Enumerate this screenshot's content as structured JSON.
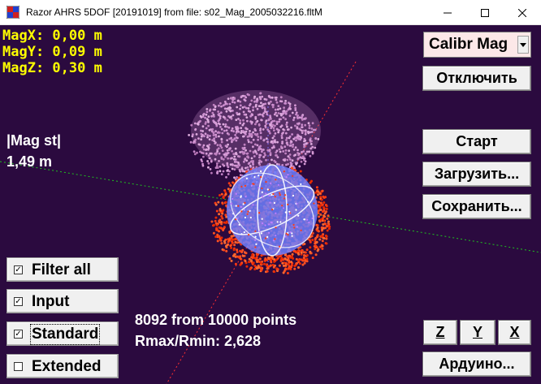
{
  "window": {
    "title": "Razor AHRS 5DOF [20191019]  from file:  s02_Mag_2005032216.fltM",
    "icon": "app-icon-ahrs",
    "controls": [
      "minimize-icon",
      "maximize-icon",
      "close-icon"
    ]
  },
  "readouts": {
    "magx": "MagX: 0,00 m",
    "magy": "MagY: 0,09 m",
    "magz": "MagZ: 0,30 m",
    "mag_st_label": "|Mag st|",
    "mag_st_value": "1,49 m",
    "points": "8092 from 10000 points",
    "ratio": "Rmax/Rmin: 2,628"
  },
  "controls": {
    "mode_combo": {
      "selected": "Calibr Mag"
    },
    "disconnect": "Отключить",
    "start": "Старт",
    "load": "Загрузить...",
    "save": "Сохранить...",
    "axis_z": "Z",
    "axis_y": "Y",
    "axis_x": "X",
    "arduino": "Ардуино..."
  },
  "filters": [
    {
      "label": "Filter all",
      "checked": true
    },
    {
      "label": "Input",
      "checked": true
    },
    {
      "label": "Standard",
      "checked": true
    },
    {
      "label": "Extended",
      "checked": false
    }
  ],
  "colors": {
    "background": "#2b0a3f",
    "readout_text": "#ffff00",
    "point_cloud_input": "#ff3a10",
    "point_cloud_upper": "#d69ad6",
    "fit_sphere": "#6f7fff",
    "axis_x": "#ff3030",
    "axis_y": "#20c020"
  }
}
